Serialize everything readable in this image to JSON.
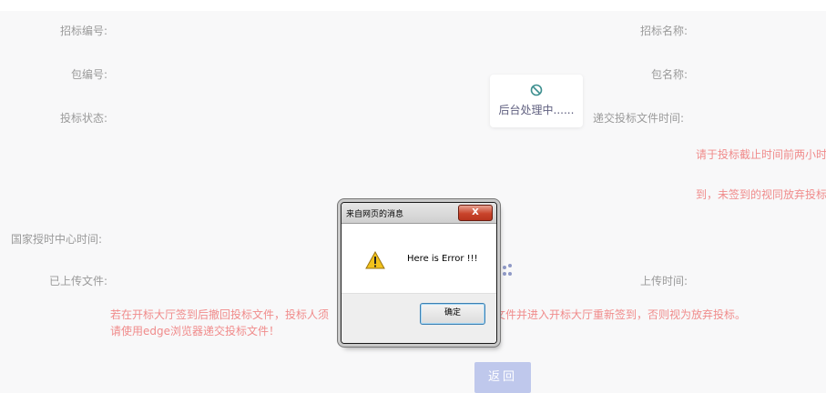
{
  "form": {
    "bid_no_label": "招标编号:",
    "bid_name_label": "招标名称:",
    "package_no_label": "包编号:",
    "package_name_label": "包名称:",
    "bid_status_label": "投标状态:",
    "submit_time_label": "递交投标文件时间:",
    "notice_line1": "请于投标截止时间前两小时",
    "notice_line2": "到，未签到的视同放弃投标",
    "ntsc_time_label": "国家授时中心时间:",
    "uploaded_file_label": "已上传文件:",
    "upload_time_label": "上传时间:",
    "warning_line1_left": "若在开标大厅签到后撤回投标文件，投标人须",
    "warning_line1_right": "文件并进入开标大厅重新签到，否则视为放弃投标。",
    "warning_line2": "请使用edge浏览器递交投标文件！",
    "return_button": "返回"
  },
  "loading": {
    "text": "后台处理中......",
    "icon": "no-entry-icon"
  },
  "dialog": {
    "title": "来自网页的消息",
    "close_label": "X",
    "message": "Here is Error !!!",
    "ok_button": "确定",
    "icon": "warning-icon"
  }
}
